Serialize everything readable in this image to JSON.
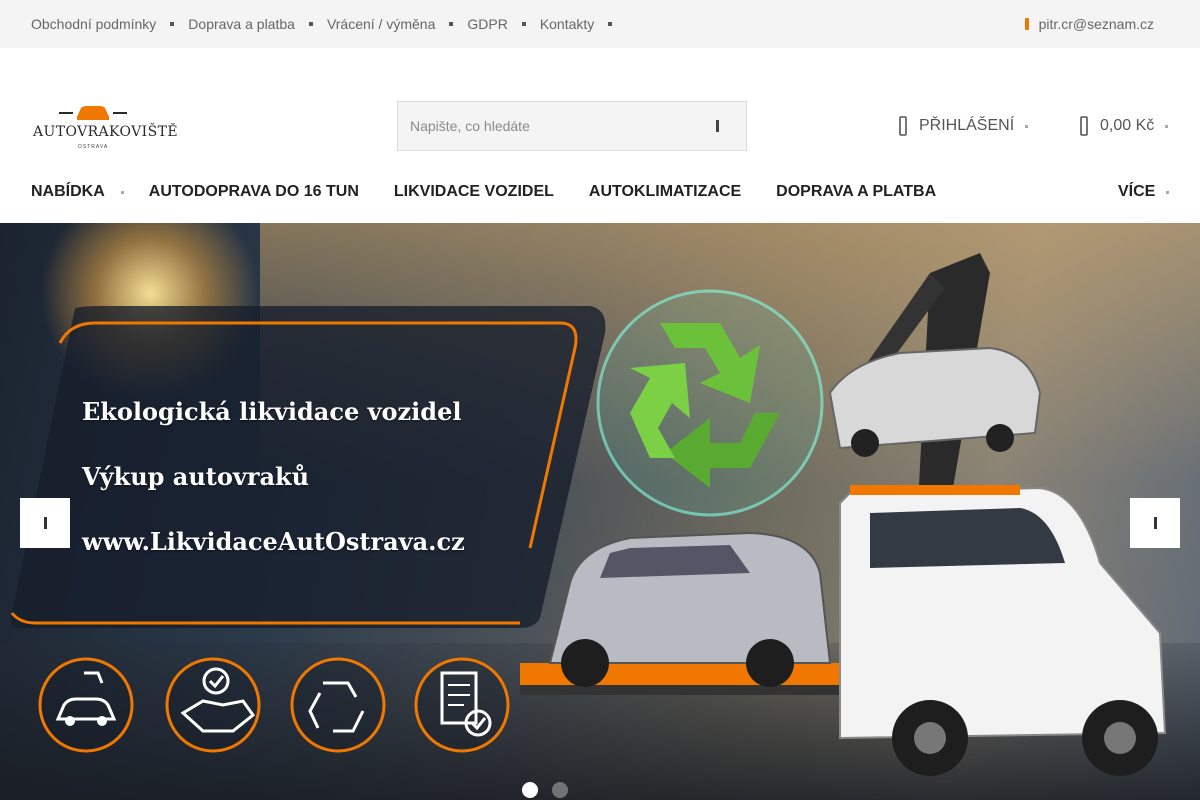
{
  "topbar": {
    "links": [
      "Obchodní podmínky",
      "Doprava a platba",
      "Vrácení / výměna",
      "GDPR",
      "Kontakty"
    ],
    "email": "pitr.cr@seznam.cz"
  },
  "logo": {
    "brand": "AUTOVRAKOVIŠTĚ",
    "subtitle": "OSTRAVA"
  },
  "search": {
    "placeholder": "Napište, co hledáte",
    "value": ""
  },
  "account": {
    "login_label": "PŘIHLÁŠENÍ",
    "cart_total": "0,00 Kč"
  },
  "nav": {
    "items": [
      "NABÍDKA",
      "AUTODOPRAVA DO 16 TUN",
      "LIKVIDACE VOZIDEL",
      "AUTOKLIMATIZACE",
      "DOPRAVA A PLATBA"
    ],
    "more_label": "VÍCE"
  },
  "hero": {
    "lines": [
      "Ekologická likvidace vozidel",
      "Výkup autovraků",
      "www.LikvidaceAutOstrava.cz"
    ],
    "slides_count": 2,
    "active_slide": 1
  },
  "colors": {
    "accent": "#f07800",
    "topbar_bg": "#f4f4f4",
    "recycle_green": "#6cc13a"
  },
  "icons": [
    "search-icon",
    "user-icon",
    "cart-icon",
    "email-icon",
    "chevron-left-icon",
    "chevron-right-icon",
    "tow-car-icon",
    "handshake-icon",
    "recycle-icon",
    "document-check-icon"
  ]
}
